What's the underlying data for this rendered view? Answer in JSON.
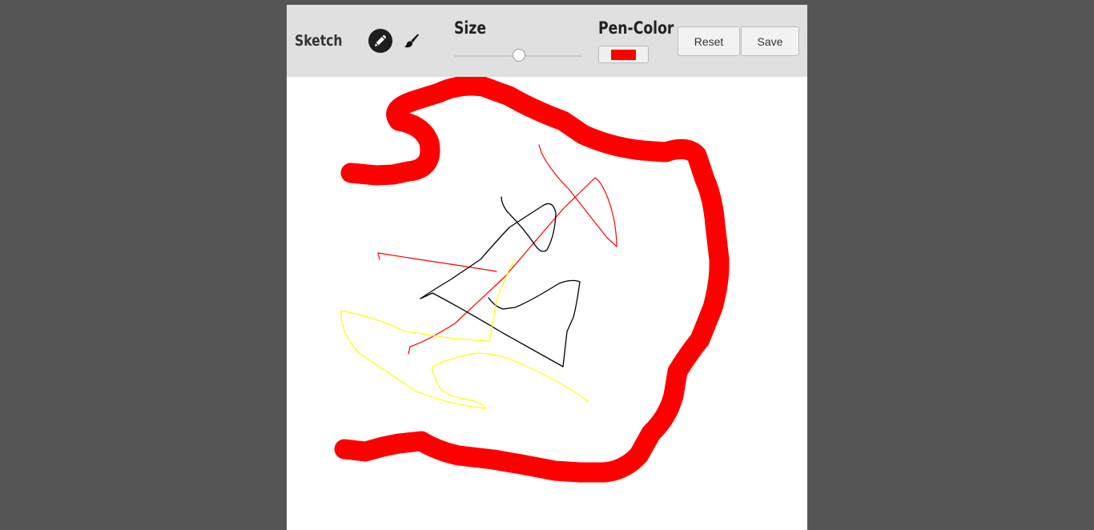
{
  "app": {
    "title": "Sketch"
  },
  "toolbar": {
    "tools": [
      {
        "icon": "pencil-icon",
        "selected": true
      },
      {
        "icon": "brush-icon",
        "selected": false
      }
    ],
    "size_label": "Size",
    "size_value": 0.51,
    "pen_color_label": "Pen-Color",
    "pen_color": "#ff0000",
    "reset_label": "Reset",
    "save_label": "Save"
  },
  "canvas": {
    "background": "#ffffff",
    "stroke_colors": [
      "#ff0000",
      "#000000",
      "#ffff00"
    ]
  }
}
